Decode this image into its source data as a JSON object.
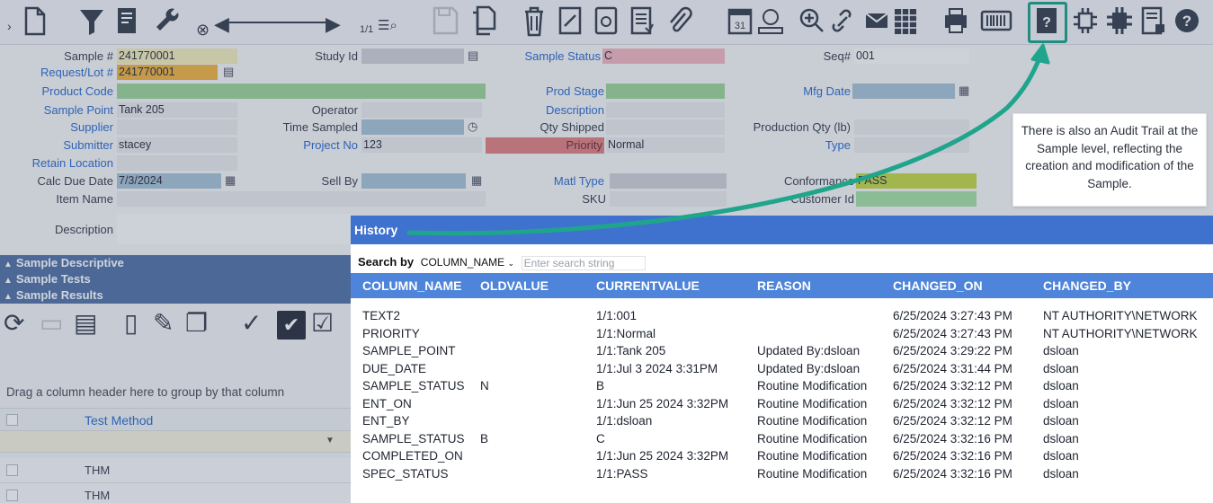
{
  "toolbar": {
    "page_indicator": "1/1",
    "icons": [
      "collapse-icon",
      "new-icon",
      "filter-icon",
      "report-icon",
      "wrench-icon",
      "clear-icon",
      "prev-icon",
      "next-icon",
      "find-icon",
      "save-icon",
      "copy-icon",
      "delete-icon",
      "sign-icon",
      "document-icon",
      "document-list-icon",
      "attachment-icon",
      "calendar-icon",
      "workflow-icon",
      "zoom-icon",
      "link-icon",
      "email-icon",
      "spreadsheet-icon",
      "print-icon",
      "barcode-icon",
      "audit-trail-icon",
      "group-icon",
      "ungroup-icon",
      "lock-icon",
      "help-icon"
    ]
  },
  "form": {
    "sample_no_label": "Sample #",
    "sample_no": "241770001",
    "request_lot_label": "Request/Lot #",
    "request_lot": "241770001",
    "product_code_label": "Product Code",
    "product_code": "",
    "sample_point_label": "Sample Point",
    "sample_point": "Tank 205",
    "supplier_label": "Supplier",
    "supplier": "",
    "submitter_label": "Submitter",
    "submitter": "stacey",
    "retain_location_label": "Retain Location",
    "retain_location": "",
    "calc_due_date_label": "Calc Due Date",
    "calc_due_date": "7/3/2024",
    "item_name_label": "Item Name",
    "item_name": "",
    "description_label": "Description",
    "description": "",
    "study_id_label": "Study Id",
    "study_id": "",
    "operator_label": "Operator",
    "operator": "",
    "time_sampled_label": "Time Sampled",
    "time_sampled": "",
    "project_no_label": "Project No",
    "project_no": "123",
    "sell_by_label": "Sell By",
    "sell_by": "",
    "sample_status_label": "Sample Status",
    "sample_status": "C",
    "prod_stage_label": "Prod Stage",
    "prod_stage": "",
    "description2_label": "Description",
    "description2": "",
    "qty_shipped_label": "Qty Shipped",
    "qty_shipped": "",
    "priority_label": "Priority",
    "priority": "Normal",
    "matl_type_label": "Matl Type",
    "matl_type": "",
    "sku_label": "SKU",
    "sku": "",
    "seq_label": "Seq#",
    "seq": "001",
    "mfg_date_label": "Mfg Date",
    "mfg_date": "",
    "production_qty_label": "Production Qty (lb)",
    "production_qty": "",
    "type_label": "Type",
    "type": "",
    "conformance_label": "Conformance",
    "conformance": "PASS",
    "customer_id_label": "Customer Id",
    "customer_id": ""
  },
  "sections": [
    "Sample Descriptive",
    "Sample Tests",
    "Sample Results"
  ],
  "grid": {
    "drag_hint": "Drag a column header here to group by that column",
    "column_test_method": "Test Method",
    "rows": [
      "THM",
      "THM"
    ]
  },
  "history": {
    "title": "History",
    "search_by_label": "Search by",
    "search_column": "COLUMN_NAME",
    "search_placeholder": "Enter search string",
    "columns": [
      "COLUMN_NAME",
      "OLDVALUE",
      "CURRENTVALUE",
      "REASON",
      "CHANGED_ON",
      "CHANGED_BY"
    ],
    "rows": [
      [
        "TEXT2",
        "",
        "1/1:001",
        "",
        "6/25/2024 3:27:43 PM",
        "NT AUTHORITY\\NETWORK"
      ],
      [
        "PRIORITY",
        "",
        "1/1:Normal",
        "",
        "6/25/2024 3:27:43 PM",
        "NT AUTHORITY\\NETWORK"
      ],
      [
        "SAMPLE_POINT",
        "",
        "1/1:Tank 205",
        "Updated By:dsloan",
        "6/25/2024 3:29:22 PM",
        "dsloan"
      ],
      [
        "DUE_DATE",
        "",
        "1/1:Jul 3 2024 3:31PM",
        "Updated By:dsloan",
        "6/25/2024 3:31:44 PM",
        "dsloan"
      ],
      [
        "SAMPLE_STATUS",
        "N",
        "B",
        "Routine Modification",
        "6/25/2024 3:32:12 PM",
        "dsloan"
      ],
      [
        "ENT_ON",
        "",
        "1/1:Jun 25 2024 3:32PM",
        "Routine Modification",
        "6/25/2024 3:32:12 PM",
        "dsloan"
      ],
      [
        "ENT_BY",
        "",
        "1/1:dsloan",
        "Routine Modification",
        "6/25/2024 3:32:12 PM",
        "dsloan"
      ],
      [
        "SAMPLE_STATUS",
        "B",
        "C",
        "Routine Modification",
        "6/25/2024 3:32:16 PM",
        "dsloan"
      ],
      [
        "COMPLETED_ON",
        "",
        "1/1:Jun 25 2024 3:32PM",
        "Routine Modification",
        "6/25/2024 3:32:16 PM",
        "dsloan"
      ],
      [
        "SPEC_STATUS",
        "",
        "1/1:PASS",
        "Routine Modification",
        "6/25/2024 3:32:16 PM",
        "dsloan"
      ]
    ]
  },
  "callout": {
    "text": "There is also an Audit Trail at the Sample level, reflecting the creation and modification of the Sample."
  },
  "colors": {
    "accent": "#3f72cf",
    "highlight": "#1fa58b",
    "section_bar": "#5575a8"
  }
}
